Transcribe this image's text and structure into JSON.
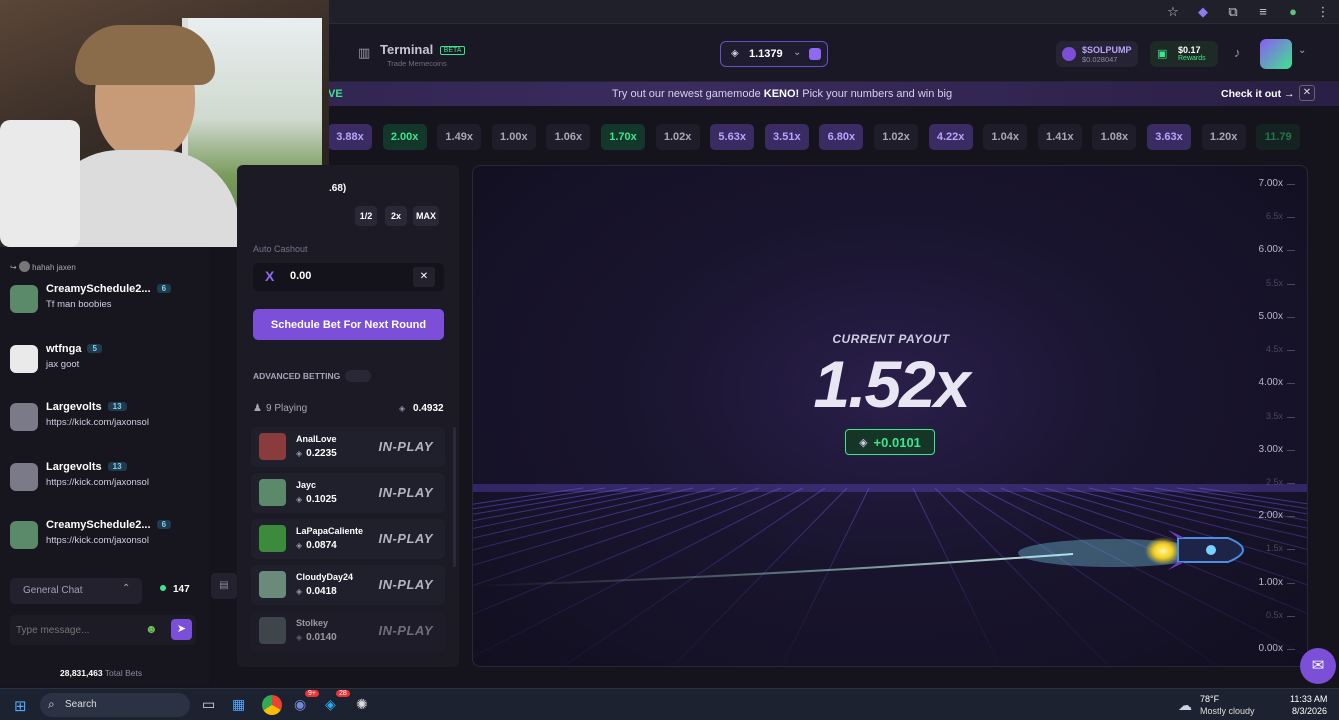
{
  "header": {
    "terminal_title": "Terminal",
    "terminal_badge": "BETA",
    "terminal_sub": "Trade Memecoins",
    "balance": "1.1379",
    "token_name": "$SOLPUMP",
    "token_price": "$0.028047",
    "rewards_amount": "$0.17",
    "rewards_label": "Rewards"
  },
  "banner": {
    "live_fragment": "VE",
    "text_pre": "Try out our newest gamemode ",
    "text_bold": "KENO!",
    "text_post": " Pick your numbers and win big",
    "link": "Check it out →"
  },
  "history": [
    {
      "v": "3.88x",
      "k": "p"
    },
    {
      "v": "2.00x",
      "k": "g"
    },
    {
      "v": "1.49x",
      "k": "n"
    },
    {
      "v": "1.00x",
      "k": "n"
    },
    {
      "v": "1.06x",
      "k": "n"
    },
    {
      "v": "1.70x",
      "k": "g"
    },
    {
      "v": "1.02x",
      "k": "n"
    },
    {
      "v": "5.63x",
      "k": "p"
    },
    {
      "v": "3.51x",
      "k": "p"
    },
    {
      "v": "6.80x",
      "k": "p"
    },
    {
      "v": "1.02x",
      "k": "n"
    },
    {
      "v": "4.22x",
      "k": "p"
    },
    {
      "v": "1.04x",
      "k": "n"
    },
    {
      "v": "1.41x",
      "k": "n"
    },
    {
      "v": "1.08x",
      "k": "n"
    },
    {
      "v": "3.63x",
      "k": "p"
    },
    {
      "v": "1.20x",
      "k": "n"
    },
    {
      "v": "11.79",
      "k": "g"
    }
  ],
  "bet": {
    "amount_fragment": ".68)",
    "half": "1/2",
    "double": "2x",
    "max": "MAX",
    "auto_cashout_label": "Auto Cashout",
    "auto_cashout_value": "0.00",
    "schedule_button": "Schedule Bet For Next Round",
    "advanced_label": "ADVANCED BETTING",
    "playing": "9 Playing",
    "pot": "0.4932"
  },
  "players": [
    {
      "name": "AnalLove",
      "amount": "0.2235",
      "status": "IN-PLAY"
    },
    {
      "name": "Jayc",
      "amount": "0.1025",
      "status": "IN-PLAY"
    },
    {
      "name": "LaPapaCaliente",
      "amount": "0.0874",
      "status": "IN-PLAY"
    },
    {
      "name": "CloudyDay24",
      "amount": "0.0418",
      "status": "IN-PLAY"
    },
    {
      "name": "Stolkey",
      "amount": "0.0140",
      "status": "IN-PLAY"
    }
  ],
  "chat": {
    "reply_to": "hahah jaxen",
    "messages": [
      {
        "user": "CreamySchedule2...",
        "level": "6",
        "text": "Tf man boobies"
      },
      {
        "user": "wtfnga",
        "level": "5",
        "text": "jax goot"
      },
      {
        "user": "Largevolts",
        "level": "13",
        "text": "https://kick.com/jaxonsol"
      },
      {
        "user": "Largevolts",
        "level": "13",
        "text": "https://kick.com/jaxonsol"
      },
      {
        "user": "CreamySchedule2...",
        "level": "6",
        "text": "https://kick.com/jaxonsol"
      }
    ],
    "channel": "General Chat",
    "online": "147",
    "placeholder": "Type message...",
    "total_bets_num": "28,831,463",
    "total_bets_label": "Total Bets"
  },
  "game": {
    "payout_label": "CURRENT PAYOUT",
    "multiplier": "1.52x",
    "profit": "+0.0101",
    "y_ticks": [
      {
        "v": "7.00x",
        "major": true
      },
      {
        "v": "6.5x",
        "major": false
      },
      {
        "v": "6.00x",
        "major": true
      },
      {
        "v": "5.5x",
        "major": false
      },
      {
        "v": "5.00x",
        "major": true
      },
      {
        "v": "4.5x",
        "major": false
      },
      {
        "v": "4.00x",
        "major": true
      },
      {
        "v": "3.5x",
        "major": false
      },
      {
        "v": "3.00x",
        "major": true
      },
      {
        "v": "2.5x",
        "major": false
      },
      {
        "v": "2.00x",
        "major": true
      },
      {
        "v": "1.5x",
        "major": false
      },
      {
        "v": "1.00x",
        "major": true
      },
      {
        "v": "0.5x",
        "major": false
      },
      {
        "v": "0.00x",
        "major": true
      }
    ]
  },
  "taskbar": {
    "search": "Search",
    "weather_temp": "78°F",
    "weather_desc": "Mostly cloudy",
    "time": "11:33 AM",
    "date": "8/3/2026",
    "notif_a": "9+",
    "notif_b": "28"
  },
  "colors": {
    "accent": "#7b4fd8",
    "green": "#3ee58c",
    "purple_chip": "#b9a3ff"
  }
}
